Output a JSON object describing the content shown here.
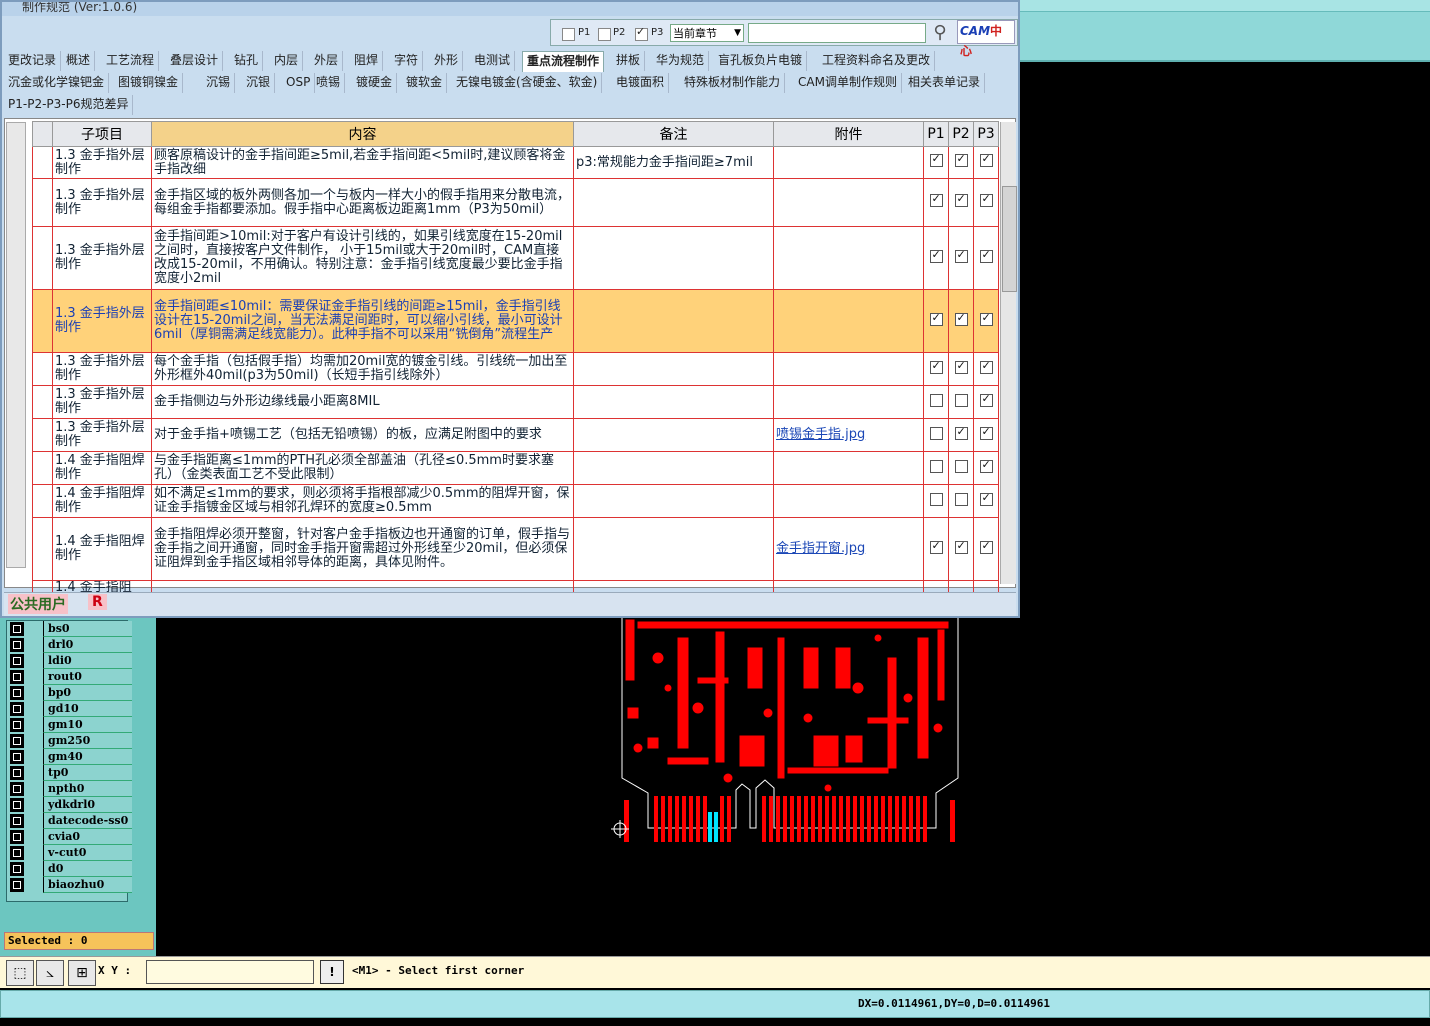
{
  "window": {
    "title": "制作规范 (Ver:1.0.6)",
    "filters": [
      {
        "label": "P1",
        "checked": false
      },
      {
        "label": "P2",
        "checked": false
      },
      {
        "label": "P3",
        "checked": true
      }
    ],
    "chapter_select": "当前章节",
    "search_placeholder": "",
    "logo_text": "CAM",
    "logo_suffix": "中心"
  },
  "tabs_row1": [
    "更改记录",
    "概述",
    "工艺流程",
    "叠层设计",
    "钻孔",
    "内层",
    "外层",
    "阻焊",
    "字符",
    "外形",
    "电测试",
    "重点流程制作",
    "拼板",
    "华为规范",
    "盲孔板负片电镀",
    "工程资料命名及更改"
  ],
  "tabs_row2": [
    "沉金或化学镍钯金",
    "图镀铜镍金",
    "沉锡",
    "沉银",
    "OSP",
    "喷锡",
    "镀硬金",
    "镀软金",
    "无镍电镀金(含硬金、软金)",
    "电镀面积",
    "特殊板材制作能力",
    "CAM调单制作规则",
    "相关表单记录"
  ],
  "tabs_row3": [
    "P1-P2-P3-P6规范差异"
  ],
  "active_tab": "重点流程制作",
  "table": {
    "headers": [
      "子项目",
      "内容",
      "备注",
      "附件",
      "P1",
      "P2",
      "P3"
    ],
    "rows": [
      {
        "sub": "1.3 金手指外层制作",
        "content": "顾客原稿设计的金手指间距≥5mil,若金手指间距<5mil时,建议顾客将金手指改细",
        "note": "p3:常规能力金手指间距≥7mil",
        "attach": "",
        "p": [
          true,
          true,
          true
        ]
      },
      {
        "sub": "1.3 金手指外层制作",
        "content": "金手指区域的板外两侧各加一个与板内一样大小的假手指用来分散电流，每组金手指都要添加。假手指中心距离板边距离1mm（P3为50mil）",
        "note": "",
        "attach": "",
        "p": [
          true,
          true,
          true
        ]
      },
      {
        "sub": "1.3 金手指外层制作",
        "content": "金手指间距>10mil:对于客户有设计引线的，如果引线宽度在15-20mil之间时，直接按客户文件制作， 小于15mil或大于20mil时，CAM直接改成15-20mil，不用确认。特别注意：金手指引线宽度最少要比金手指宽度小2mil",
        "note": "",
        "attach": "",
        "p": [
          true,
          true,
          true
        ]
      },
      {
        "sub": "1.3 金手指外层制作",
        "content": "金手指间距≤10mil：需要保证金手指引线的间距≥15mil，金手指引线设计在15-20mil之间，当无法满足间距时，可以缩小引线，最小可设计6mil（厚铜需满足线宽能力）。此种手指不可以采用“铣倒角”流程生产",
        "note": "",
        "attach": "",
        "p": [
          true,
          true,
          true
        ],
        "selected": true
      },
      {
        "sub": "1.3 金手指外层制作",
        "content": "每个金手指（包括假手指）均需加20mil宽的镀金引线。引线统一加出至外形框外40mil(p3为50mil)（长短手指引线除外）",
        "note": "",
        "attach": "",
        "p": [
          true,
          true,
          true
        ]
      },
      {
        "sub": "1.3 金手指外层制作",
        "content": "金手指侧边与外形边缘线最小距离8MIL",
        "note": "",
        "attach": "",
        "p": [
          false,
          false,
          true
        ]
      },
      {
        "sub": "1.3 金手指外层制作",
        "content": "对于金手指+喷锡工艺（包括无铅喷锡）的板，应满足附图中的要求",
        "note": "",
        "attach": "喷锡金手指.jpg",
        "p": [
          false,
          true,
          true
        ]
      },
      {
        "sub": "1.4 金手指阻焊制作",
        "content": "与金手指距离≤1mm的PTH孔必须全部盖油（孔径≤0.5mm时要求塞孔）（金类表面工艺不受此限制）",
        "note": "",
        "attach": "",
        "p": [
          false,
          false,
          true
        ]
      },
      {
        "sub": "1.4 金手指阻焊制作",
        "content": "如不满足≤1mm的要求，则必须将手指根部减少0.5mm的阻焊开窗，保证金手指镀金区域与相邻孔焊环的宽度≥0.5mm",
        "note": "",
        "attach": "",
        "p": [
          false,
          false,
          true
        ]
      },
      {
        "sub": "1.4 金手指阻焊制作",
        "content": "金手指阻焊必须开整窗，针对客户金手指板边也开通窗的订单，假手指与金手指之间开通窗，同时金手指开窗需超过外形线至少20mil，但必须保证阻焊到金手指区域相邻导体的距离，具体见附件。",
        "note": "",
        "attach": "金手指开窗.jpg",
        "p": [
          true,
          true,
          true
        ]
      },
      {
        "sub": "1.4 金手指阻",
        "content": "",
        "note": "",
        "attach": "",
        "p": [
          false,
          false,
          false
        ]
      }
    ]
  },
  "user": {
    "name": "公共用户",
    "badge": "R"
  },
  "cad": {
    "layers": [
      "bs0",
      "drl0",
      "ldi0",
      "rout0",
      "bp0",
      "gd10",
      "gm10",
      "gm250",
      "gm40",
      "tp0",
      "npth0",
      "ydkdrl0",
      "datecode-ss0",
      "cvia0",
      "v-cut0",
      "d0",
      "biaozhu0"
    ],
    "selected_text": "Selected : 0",
    "xy_label": "X Y :",
    "xy_value": "",
    "prompt": "<M1> - Select first corner",
    "status": "DX=0.0114961,DY=0,D=0.0114961",
    "board_color": "#ff0000",
    "highlight_color": "#00e5ff"
  }
}
